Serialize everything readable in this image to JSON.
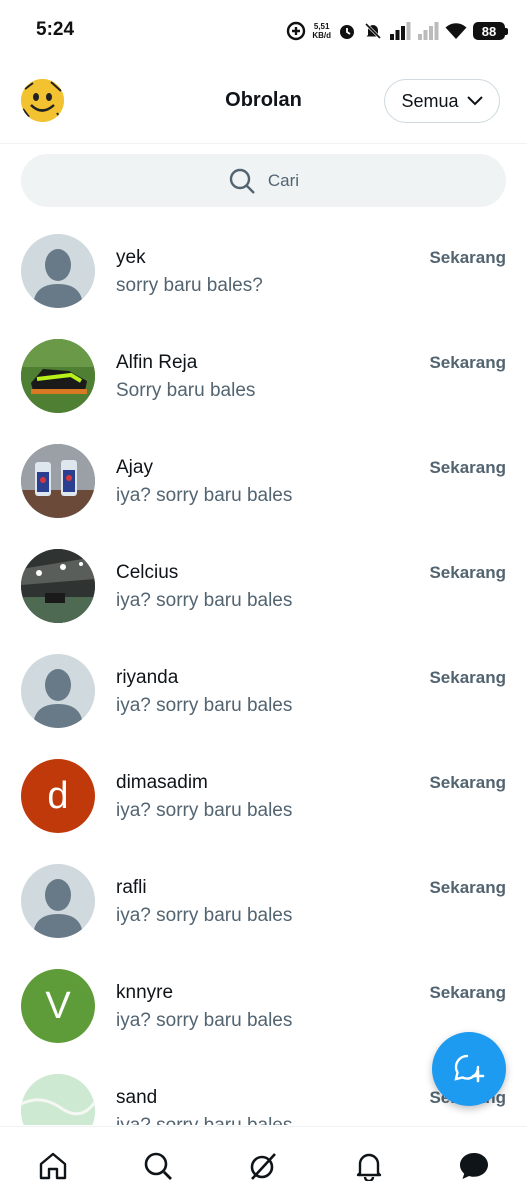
{
  "status_bar": {
    "time": "5:24",
    "speed_value": "5,51",
    "speed_unit": "KB/d",
    "battery": "88"
  },
  "header": {
    "title": "Obrolan",
    "filter_label": "Semua"
  },
  "search": {
    "placeholder": "Cari"
  },
  "conversations": [
    {
      "name": "yek",
      "preview": "sorry baru bales?",
      "time": "Sekarang",
      "avatar": "default"
    },
    {
      "name": "Alfin Reja",
      "preview": "Sorry baru bales",
      "time": "Sekarang",
      "avatar": "photo-shoe"
    },
    {
      "name": "Ajay",
      "preview": "iya? sorry baru bales",
      "time": "Sekarang",
      "avatar": "photo-drinks"
    },
    {
      "name": "Celcius",
      "preview": "iya? sorry baru bales",
      "time": "Sekarang",
      "avatar": "photo-hall"
    },
    {
      "name": "riyanda",
      "preview": "iya? sorry baru bales",
      "time": "Sekarang",
      "avatar": "default"
    },
    {
      "name": "dimasadim",
      "preview": "iya? sorry baru bales",
      "time": "Sekarang",
      "avatar": "letter",
      "letter": "d",
      "color": "#c0390b"
    },
    {
      "name": "rafli",
      "preview": "iya? sorry baru bales",
      "time": "Sekarang",
      "avatar": "default"
    },
    {
      "name": "knnyre",
      "preview": "iya? sorry baru bales",
      "time": "Sekarang",
      "avatar": "letter",
      "letter": "V",
      "color": "#5e9c3a"
    },
    {
      "name": "sand",
      "preview": "iya? sorry baru bales",
      "time": "Sekarang",
      "avatar": "photo-map"
    }
  ],
  "fab": {
    "icon": "new-message-icon"
  },
  "bottom_nav": [
    {
      "id": "home",
      "icon": "home-icon"
    },
    {
      "id": "search",
      "icon": "search-icon"
    },
    {
      "id": "grok",
      "icon": "grok-icon"
    },
    {
      "id": "notifications",
      "icon": "bell-icon"
    },
    {
      "id": "messages",
      "icon": "chat-icon"
    }
  ],
  "colors": {
    "accent": "#1d9bf0",
    "text_primary": "#0f1419",
    "text_secondary": "#536471",
    "search_bg": "#eff3f4"
  }
}
